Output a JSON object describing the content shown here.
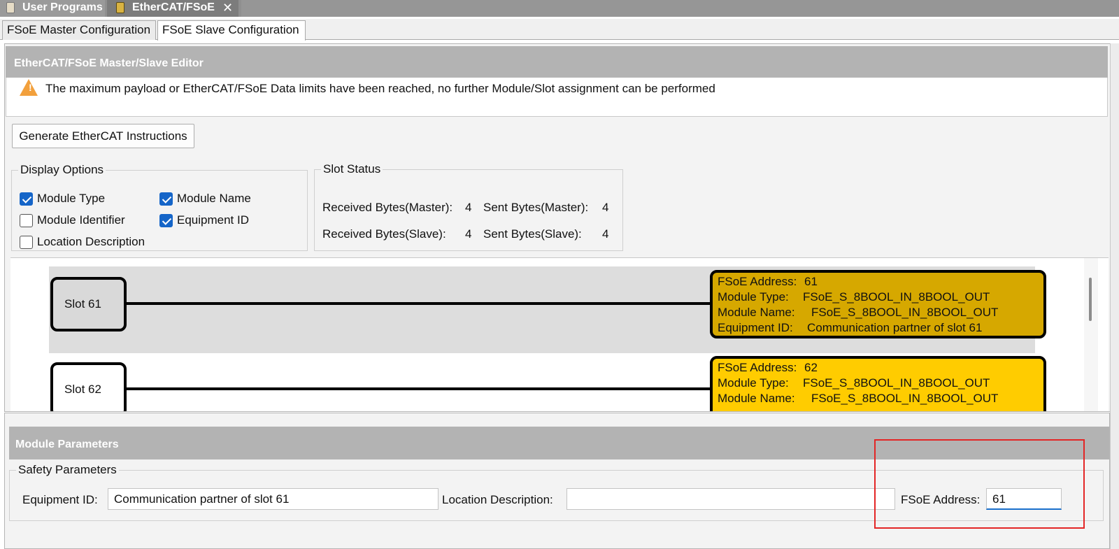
{
  "top_tabs": [
    {
      "label": "User Programs"
    },
    {
      "label": "EtherCAT/FSoE"
    }
  ],
  "sub_tabs": [
    {
      "label": "FSoE Master Configuration"
    },
    {
      "label": "FSoE Slave Configuration"
    }
  ],
  "editor": {
    "title": "EtherCAT/FSoE Master/Slave Editor",
    "warning": "The maximum payload or EtherCAT/FSoE Data limits have been reached, no further Module/Slot assignment can be performed",
    "generate_button": "Generate EtherCAT Instructions"
  },
  "display_options": {
    "legend": "Display Options",
    "items": [
      {
        "label": "Module Type",
        "checked": true
      },
      {
        "label": "Module Name",
        "checked": true
      },
      {
        "label": "Module Identifier",
        "checked": false
      },
      {
        "label": "Equipment ID",
        "checked": true
      },
      {
        "label": "Location Description",
        "checked": false
      }
    ]
  },
  "slot_status": {
    "legend": "Slot Status",
    "received_master_label": "Received Bytes(Master):",
    "received_master_value": "4",
    "sent_master_label": "Sent Bytes(Master):",
    "sent_master_value": "4",
    "received_slave_label": "Received Bytes(Slave):",
    "received_slave_value": "4",
    "sent_slave_label": "Sent Bytes(Slave):",
    "sent_slave_value": "4"
  },
  "slots": [
    {
      "label": "Slot 61",
      "address_label": "FSoE Address:",
      "address": "61",
      "module_type_label": "Module Type:",
      "module_type": "FSoE_S_8BOOL_IN_8BOOL_OUT",
      "module_name_label": "Module Name:",
      "module_name": "FSoE_S_8BOOL_IN_8BOOL_OUT",
      "equipment_label": "Equipment ID:",
      "equipment": "Communication partner of slot 61"
    },
    {
      "label": "Slot 62",
      "address_label": "FSoE Address:",
      "address": "62",
      "module_type_label": "Module Type:",
      "module_type": "FSoE_S_8BOOL_IN_8BOOL_OUT",
      "module_name_label": "Module Name:",
      "module_name": "FSoE_S_8BOOL_IN_8BOOL_OUT"
    }
  ],
  "module_parameters": {
    "title": "Module Parameters",
    "safety_legend": "Safety Parameters",
    "equipment_label": "Equipment ID:",
    "equipment_value": "Communication partner of slot 61",
    "location_label": "Location Description:",
    "location_value": "",
    "address_label": "FSoE Address:",
    "address_value": "61"
  },
  "colors": {
    "selected_module": "#d6a800",
    "module": "#ffcc00",
    "highlight_frame": "#e32626",
    "checkbox": "#1565c8"
  }
}
